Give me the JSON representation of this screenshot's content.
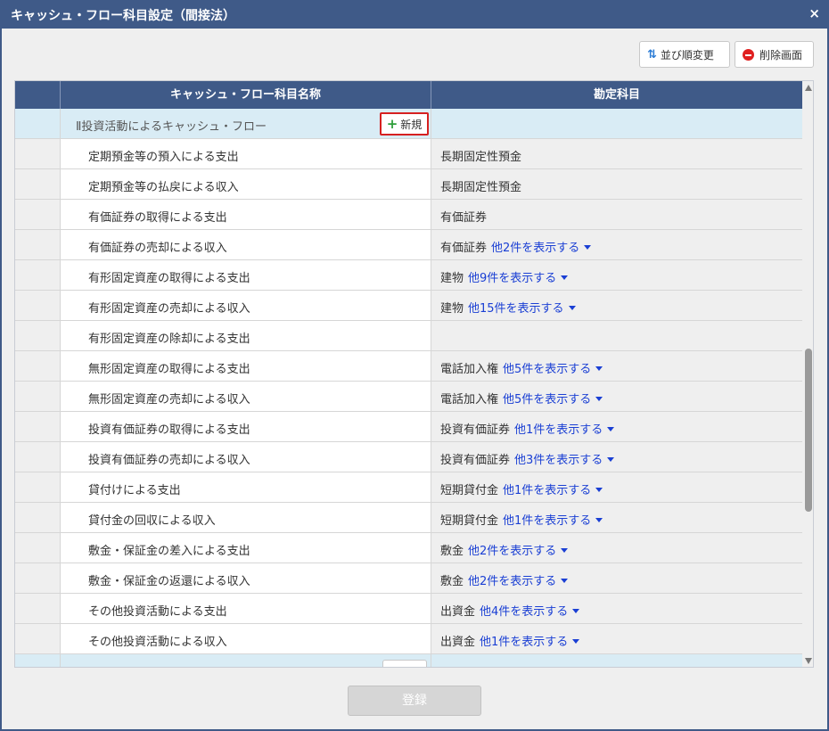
{
  "window": {
    "title": "キャッシュ・フロー科目設定（間接法）",
    "close": "×"
  },
  "toolbar": {
    "sort_label": "並び順変更",
    "delete_label": "削除画面"
  },
  "table": {
    "columns": [
      "",
      "キャッシュ・フロー科目名称",
      "勘定科目"
    ],
    "section": {
      "label": "Ⅱ投資活動によるキャッシュ・フロー",
      "new_label": "新規"
    },
    "rows": [
      {
        "name": "定期預金等の預入による支出",
        "account": "長期固定性預金",
        "more": ""
      },
      {
        "name": "定期預金等の払戻による収入",
        "account": "長期固定性預金",
        "more": ""
      },
      {
        "name": "有価証券の取得による支出",
        "account": "有価証券",
        "more": ""
      },
      {
        "name": "有価証券の売却による収入",
        "account": "有価証券",
        "more": "他2件を表示する"
      },
      {
        "name": "有形固定資産の取得による支出",
        "account": "建物",
        "more": "他9件を表示する"
      },
      {
        "name": "有形固定資産の売却による収入",
        "account": "建物",
        "more": "他15件を表示する"
      },
      {
        "name": "有形固定資産の除却による支出",
        "account": "",
        "more": ""
      },
      {
        "name": "無形固定資産の取得による支出",
        "account": "電話加入権",
        "more": "他5件を表示する"
      },
      {
        "name": "無形固定資産の売却による収入",
        "account": "電話加入権",
        "more": "他5件を表示する"
      },
      {
        "name": "投資有価証券の取得による支出",
        "account": "投資有価証券",
        "more": "他1件を表示する"
      },
      {
        "name": "投資有価証券の売却による収入",
        "account": "投資有価証券",
        "more": "他3件を表示する"
      },
      {
        "name": "貸付けによる支出",
        "account": "短期貸付金",
        "more": "他1件を表示する"
      },
      {
        "name": "貸付金の回収による収入",
        "account": "短期貸付金",
        "more": "他1件を表示する"
      },
      {
        "name": "敷金・保証金の差入による支出",
        "account": "敷金",
        "more": "他2件を表示する"
      },
      {
        "name": "敷金・保証金の返還による収入",
        "account": "敷金",
        "more": "他2件を表示する"
      },
      {
        "name": "その他投資活動による支出",
        "account": "出資金",
        "more": "他4件を表示する"
      },
      {
        "name": "その他投資活動による収入",
        "account": "出資金",
        "more": "他1件を表示する"
      }
    ]
  },
  "footer": {
    "register_label": "登録"
  },
  "colors": {
    "header_bg": "#3f5a88",
    "section_bg": "#d9ecf5",
    "link": "#1a3fd4",
    "highlight_border": "#d62020"
  }
}
